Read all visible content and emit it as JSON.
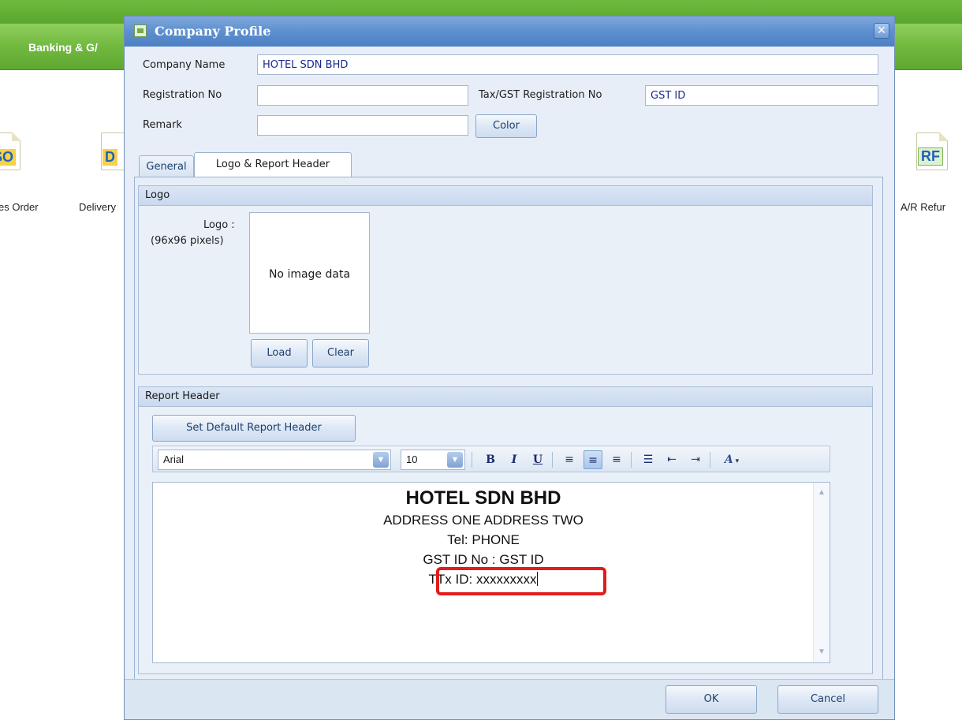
{
  "app": {
    "menu_item": "Banking & G/",
    "icons": [
      {
        "badge": "SO",
        "label": "es Order",
        "icon": "sales-order-icon"
      },
      {
        "badge": "D",
        "label": "Delivery",
        "icon": "delivery-order-icon"
      },
      {
        "badge": "RF",
        "label": "A/R Refur",
        "icon": "ar-refund-icon"
      }
    ]
  },
  "dialog": {
    "title": "Company Profile",
    "close_glyph": "✕",
    "company_name_label": "Company Name",
    "company_name_value": "HOTEL SDN BHD",
    "registration_no_label": "Registration No",
    "registration_no_value": "",
    "tax_gst_label": "Tax/GST Registration No",
    "tax_gst_value": "GST ID",
    "remark_label": "Remark",
    "remark_value": "",
    "color_button": "Color",
    "tabs": [
      {
        "label": "General",
        "active": false
      },
      {
        "label": "Logo & Report Header",
        "active": true
      }
    ],
    "logo_group": {
      "header": "Logo",
      "label_line1": "Logo :",
      "label_line2": "(96x96 pixels)",
      "placeholder": "No image data",
      "load_button": "Load",
      "clear_button": "Clear"
    },
    "report_header_group": {
      "header": "Report Header",
      "set_default_button": "Set Default Report Header",
      "font_family": "Arial",
      "font_size": "10",
      "toolbar_glyphs": {
        "bold": "B",
        "italic": "I",
        "underline": "U",
        "align_left": "≡",
        "align_center": "≡",
        "align_right": "≡",
        "bullets": "☰",
        "outdent": "⇤",
        "indent": "⇥",
        "font_color": "A"
      },
      "content": {
        "line1": "HOTEL SDN BHD",
        "line2": "ADDRESS ONE ADDRESS TWO",
        "line3": "Tel: PHONE",
        "line4": "GST ID No : GST ID",
        "line5": "TTx ID: xxxxxxxxx"
      },
      "highlight_color": "#e31b1b"
    },
    "ok_button": "OK",
    "cancel_button": "Cancel"
  }
}
